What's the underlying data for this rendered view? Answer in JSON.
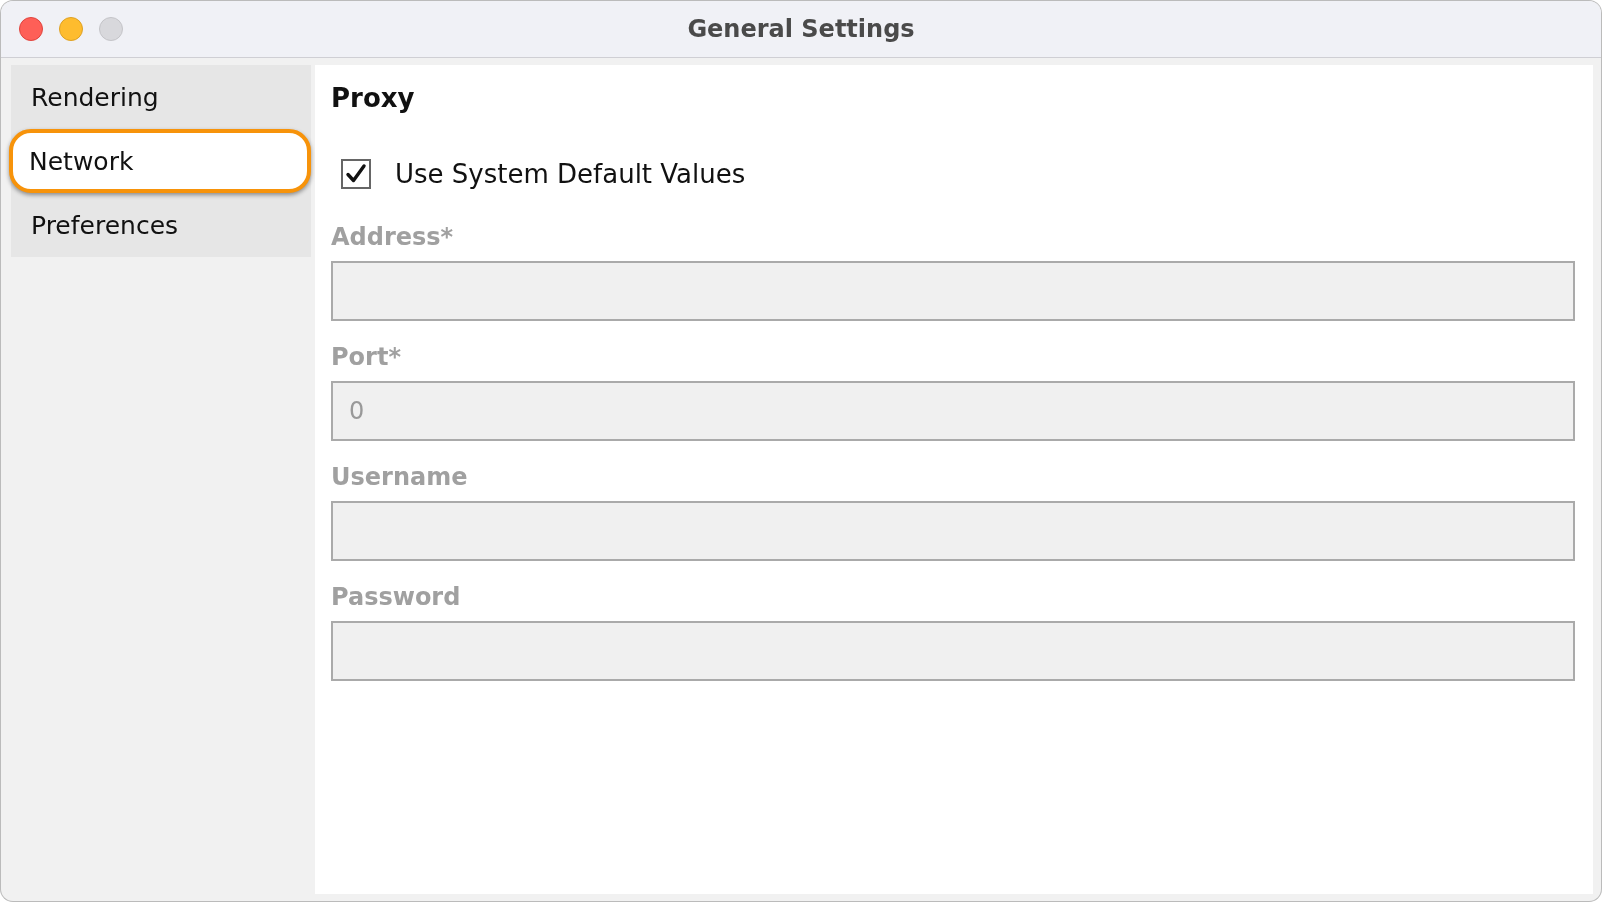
{
  "window": {
    "title": "General Settings"
  },
  "sidebar": {
    "items": [
      {
        "label": "Rendering",
        "selected": false
      },
      {
        "label": "Network",
        "selected": true
      },
      {
        "label": "Preferences",
        "selected": false
      }
    ]
  },
  "section": {
    "title": "Proxy",
    "checkbox": {
      "label": "Use System Default Values",
      "checked": true
    },
    "fields": [
      {
        "label": "Address*",
        "disabled": true
      },
      {
        "label": "Port*",
        "value": "0",
        "disabled": true
      },
      {
        "label": "Username",
        "disabled": true
      },
      {
        "label": "Password",
        "disabled": true
      }
    ]
  }
}
